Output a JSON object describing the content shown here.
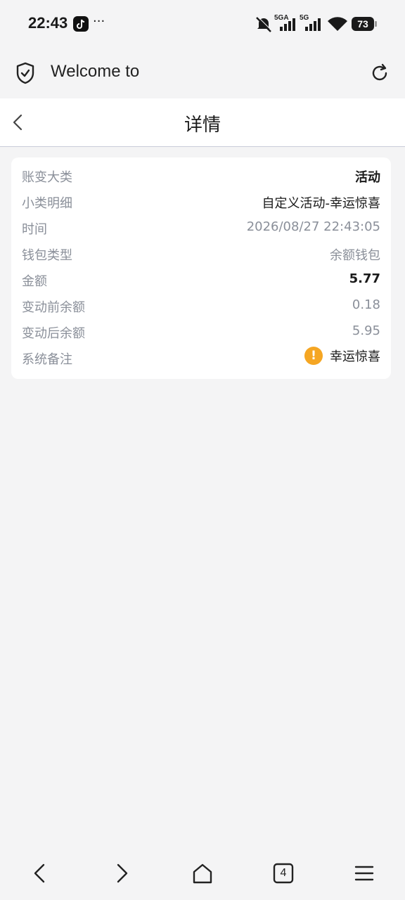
{
  "status_bar": {
    "time": "22:43",
    "network_1": "5GA",
    "network_2": "5G",
    "battery": "73"
  },
  "browser": {
    "title": "Welcome to",
    "tab_count": "4"
  },
  "page": {
    "title": "详情"
  },
  "details": [
    {
      "label": "账变大类",
      "value": "活动"
    },
    {
      "label": "小类明细",
      "value": "自定义活动-幸运惊喜"
    },
    {
      "label": "时间",
      "value": "2026/08/27 22:43:05"
    },
    {
      "label": "钱包类型",
      "value": "余额钱包"
    },
    {
      "label": "金额",
      "value": "5.77"
    },
    {
      "label": "变动前余额",
      "value": "0.18"
    },
    {
      "label": "变动后余额",
      "value": "5.95"
    },
    {
      "label": "系统备注",
      "value": "幸运惊喜"
    }
  ],
  "colors": {
    "background": "#f4f4f5",
    "card": "#ffffff",
    "label": "#8a8f99",
    "warning": "#f5a623"
  }
}
